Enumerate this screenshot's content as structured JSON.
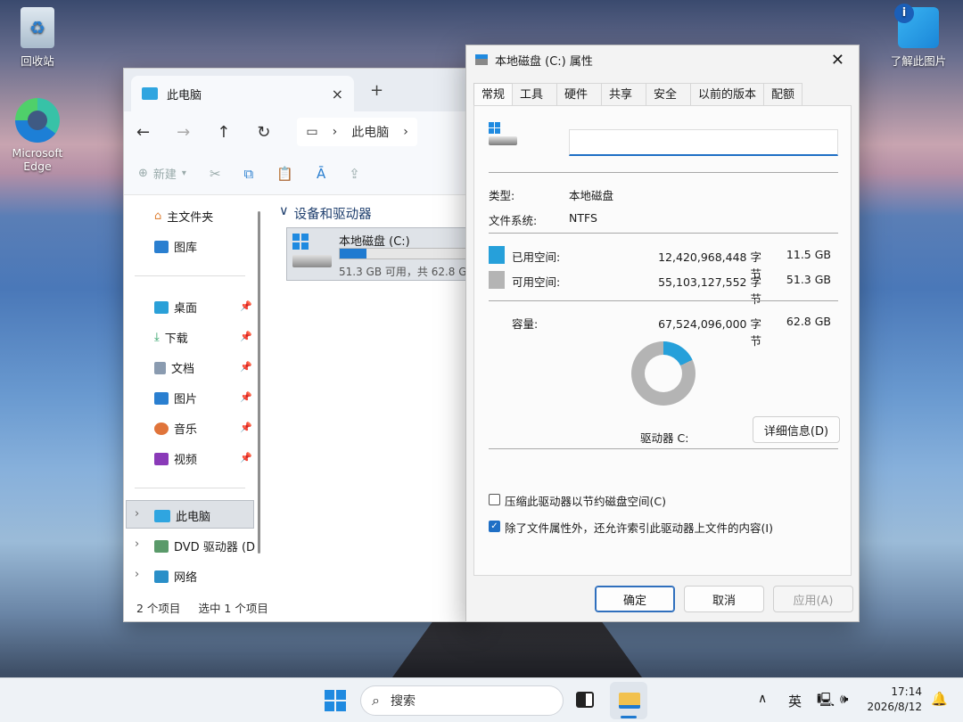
{
  "desktop": {
    "icons": [
      {
        "label": "回收站"
      },
      {
        "label": "Microsoft Edge"
      },
      {
        "label": "了解此图片"
      }
    ]
  },
  "explorer": {
    "tab_title": "此电脑",
    "tab_close": "×",
    "new_tab": "+",
    "address": [
      "此电脑"
    ],
    "command_new": "新建",
    "sidebar": {
      "top": [
        "主文件夹",
        "图库"
      ],
      "pinned": [
        "桌面",
        "下载",
        "文档",
        "图片",
        "音乐",
        "视频"
      ],
      "tree": [
        "此电脑",
        "DVD 驱动器 (D",
        "网络"
      ]
    },
    "group_header": "设备和驱动器",
    "drive": {
      "name": "本地磁盘 (C:)",
      "space_text": "51.3 GB 可用，共 62.8 G",
      "used_fraction": 0.18
    },
    "status": {
      "items": "2 个项目",
      "selected": "选中 1 个项目"
    }
  },
  "dialog": {
    "title": "本地磁盘 (C:) 属性",
    "close": "✕",
    "tabs": [
      "常规",
      "工具",
      "硬件",
      "共享",
      "安全",
      "以前的版本",
      "配额"
    ],
    "name_value": "",
    "type_label": "类型:",
    "type_value": "本地磁盘",
    "fs_label": "文件系统:",
    "fs_value": "NTFS",
    "used_label": "已用空间:",
    "used_bytes": "12,420,968,448 字节",
    "used_gb": "11.5 GB",
    "free_label": "可用空间:",
    "free_bytes": "55,103,127,552 字节",
    "free_gb": "51.3 GB",
    "capacity_label": "容量:",
    "capacity_bytes": "67,524,096,000 字节",
    "capacity_gb": "62.8 GB",
    "drive_label": "驱动器 C:",
    "details_button": "详细信息(D)",
    "compress_label": "压缩此驱动器以节约磁盘空间(C)",
    "compress_checked": false,
    "index_label": "除了文件属性外，还允许索引此驱动器上文件的内容(I)",
    "index_checked": true,
    "ok": "确定",
    "cancel": "取消",
    "apply": "应用(A)",
    "colors": {
      "used": "#26a0da",
      "free": "#b4b4b4"
    }
  },
  "taskbar": {
    "search_placeholder": "搜索",
    "ime": "英",
    "time": "17:14",
    "date": "2026/8/12"
  }
}
